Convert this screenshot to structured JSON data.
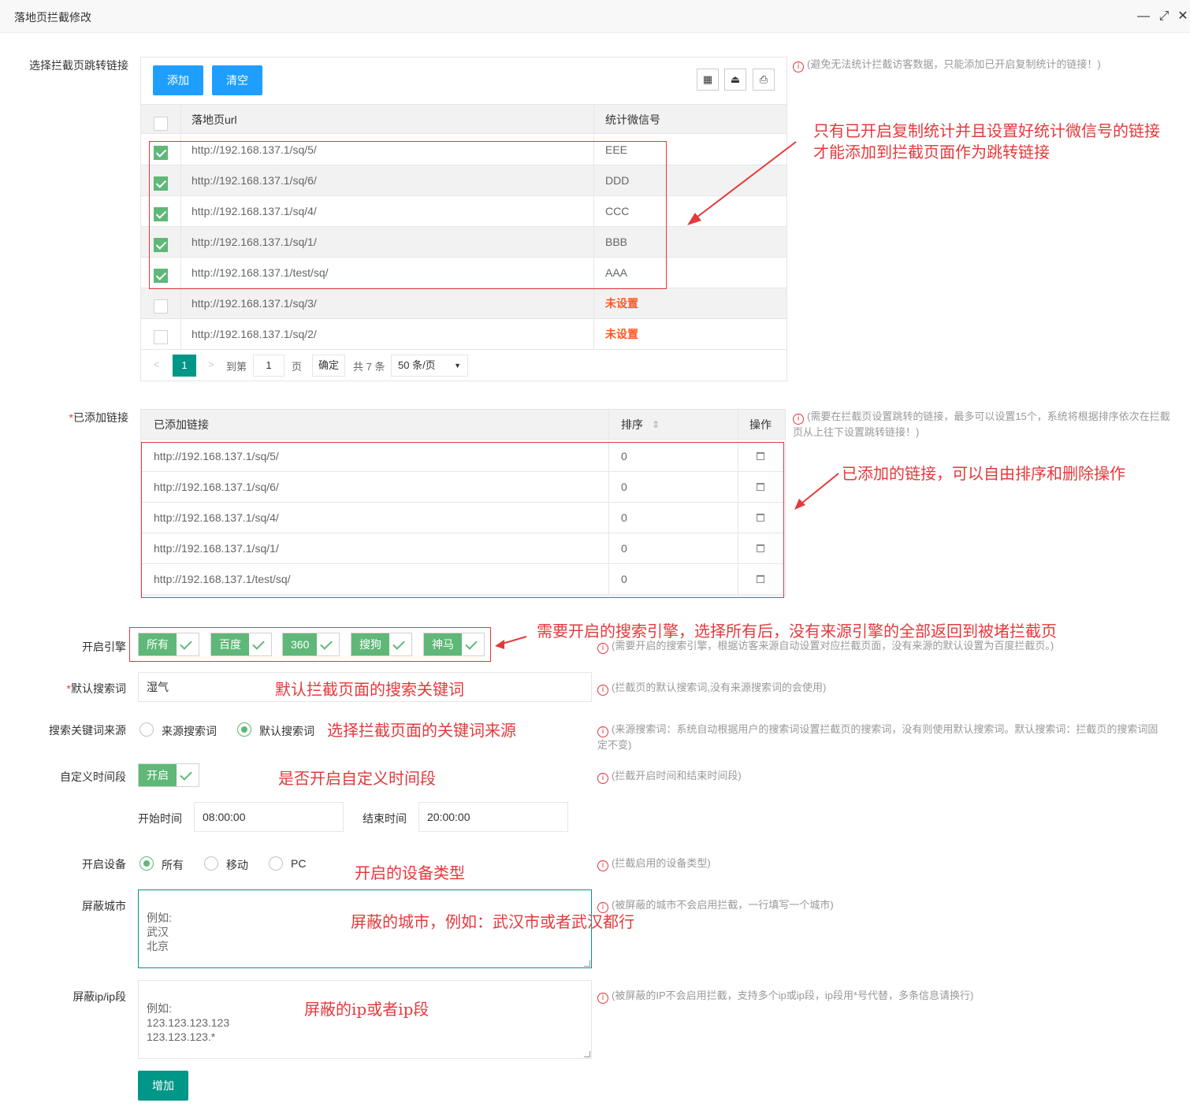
{
  "window": {
    "title": "落地页拦截修改",
    "min_glyph": "—",
    "max_glyph": "⤢",
    "close_glyph": "✕"
  },
  "section_links": {
    "label": "选择拦截页跳转链接",
    "add_label": "添加",
    "clear_label": "清空",
    "tool_icons": [
      "grid-icon",
      "export-icon",
      "print-icon"
    ],
    "tool_glyphs": [
      "▦",
      "⏏",
      "⎙"
    ],
    "hint": "(避免无法统计拦截访客数据，只能添加已开启复制统计的链接！)",
    "columns": [
      "落地页url",
      "统计微信号"
    ],
    "rows": [
      {
        "url": "http://192.168.137.1/sq/5/",
        "wechat": "EEE",
        "checked": true
      },
      {
        "url": "http://192.168.137.1/sq/6/",
        "wechat": "DDD",
        "checked": true
      },
      {
        "url": "http://192.168.137.1/sq/4/",
        "wechat": "CCC",
        "checked": true
      },
      {
        "url": "http://192.168.137.1/sq/1/",
        "wechat": "BBB",
        "checked": true
      },
      {
        "url": "http://192.168.137.1/test/sq/",
        "wechat": "AAA",
        "checked": true
      },
      {
        "url": "http://192.168.137.1/sq/3/",
        "wechat": "未设置",
        "checked": false
      },
      {
        "url": "http://192.168.137.1/sq/2/",
        "wechat": "未设置",
        "checked": false
      }
    ],
    "pager": {
      "prev": "<",
      "page": "1",
      "next": ">",
      "goto": "到第",
      "page_input": "1",
      "page_unit": "页",
      "confirm": "确定",
      "total": "共 7 条",
      "per_page": "50 条/页",
      "caret": "▼"
    }
  },
  "section_added": {
    "required_mark": "*",
    "label": "已添加链接",
    "columns": [
      "已添加链接",
      "排序",
      "操作"
    ],
    "sort_glyph": "⇕",
    "hint": "(需要在拦截页设置跳转的链接，最多可以设置15个，系统将根据排序依次在拦截页从上往下设置跳转链接！)",
    "rows": [
      {
        "url": "http://192.168.137.1/sq/5/",
        "order": "0"
      },
      {
        "url": "http://192.168.137.1/sq/6/",
        "order": "0"
      },
      {
        "url": "http://192.168.137.1/sq/4/",
        "order": "0"
      },
      {
        "url": "http://192.168.137.1/sq/1/",
        "order": "0"
      },
      {
        "url": "http://192.168.137.1/test/sq/",
        "order": "0"
      }
    ]
  },
  "engines": {
    "label": "开启引擎",
    "items": [
      "所有",
      "百度",
      "360",
      "搜狗",
      "神马"
    ],
    "hint": "(需要开启的搜索引擎，根据访客来源自动设置对应拦截页面，没有来源的默认设置为百度拦截页。)"
  },
  "keyword": {
    "required_mark": "*",
    "label": "默认搜索词",
    "value": "湿气",
    "hint": "(拦截页的默认搜索词,没有来源搜索词的会使用)"
  },
  "keyword_source": {
    "label": "搜索关键词来源",
    "options": [
      "来源搜索词",
      "默认搜索词"
    ],
    "selected": "默认搜索词",
    "hint": "(来源搜索词：系统自动根据用户的搜索词设置拦截页的搜索词，没有则使用默认搜索词。默认搜索词：拦截页的搜索词固定不变)"
  },
  "custom_time": {
    "label": "自定义时间段",
    "switch_label": "开启",
    "hint": "(拦截开启时间和结束时间段)",
    "start_label": "开始时间",
    "start_value": "08:00:00",
    "end_label": "结束时间",
    "end_value": "20:00:00"
  },
  "devices": {
    "label": "开启设备",
    "options": [
      "所有",
      "移动",
      "PC"
    ],
    "selected": "所有",
    "hint": "(拦截启用的设备类型)"
  },
  "block_city": {
    "label": "屏蔽城市",
    "placeholder": "例如:\n武汉\n北京",
    "hint": "(被屏蔽的城市不会启用拦截，一行填写一个城市)"
  },
  "block_ip": {
    "label": "屏蔽ip/ip段",
    "placeholder": "例如:\n123.123.123.123\n123.123.123.*",
    "hint": "(被屏蔽的IP不会启用拦截，支持多个ip或ip段，ip段用*号代替，多条信息请换行)"
  },
  "submit_label": "增加",
  "hint_icon": "i",
  "annotations": [
    "只有已开启复制统计并且设置好统计微信号的链接",
    "才能添加到拦截页面作为跳转链接",
    "已添加的链接，可以自由排序和删除操作",
    "需要开启的搜索引擎，选择所有后，没有来源引擎的全部返回到被堵拦截页",
    "默认拦截页面的搜索关键词",
    "选择拦截页面的关键词来源",
    "是否开启自定义时间段",
    "开启的设备类型",
    "屏蔽的城市，例如：武汉市或者武汉都行",
    "屏蔽的ip或者ip段"
  ],
  "colors": {
    "primary_green": "#009688",
    "check_green": "#5fb878",
    "blue": "#1e9fff",
    "annotation_red": "#e4393c",
    "not_set": "#ff5722"
  }
}
